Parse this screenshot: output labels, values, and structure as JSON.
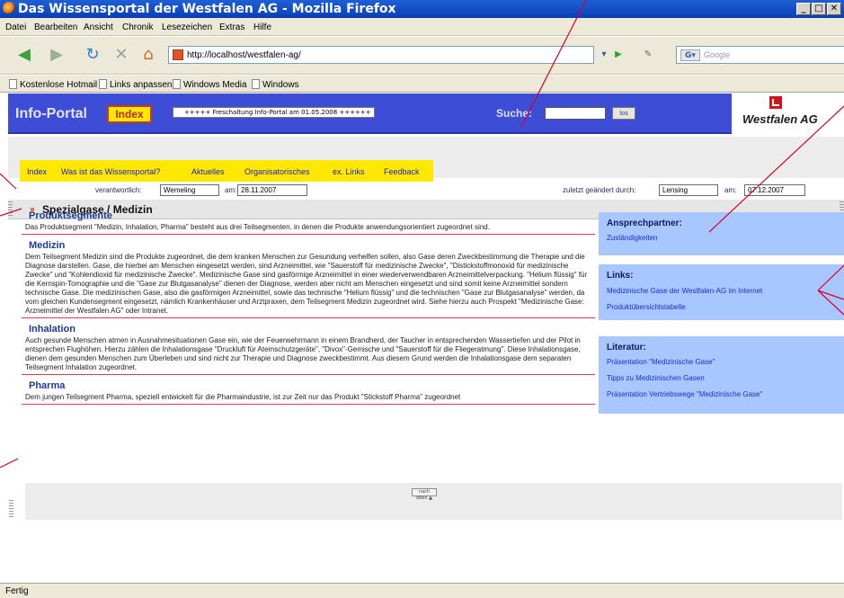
{
  "window": {
    "title": "Das Wissensportal der Westfalen AG - Mozilla Firefox",
    "controls": [
      "_",
      "□",
      "✕"
    ]
  },
  "menu": [
    "Datei",
    "Bearbeiten",
    "Ansicht",
    "Chronik",
    "Lesezeichen",
    "Extras",
    "Hilfe"
  ],
  "toolbar": {
    "url": "http://localhost/westfalen-ag/",
    "search_placeholder": "Google",
    "search_engine_label": "G"
  },
  "bookmarks": [
    "Kostenlose Hotmail",
    "Links anpassen",
    "Windows Media",
    "Windows"
  ],
  "header": {
    "brand": "Info-Portal",
    "index_button": "Index",
    "ticker": "+++++ Freschaltung Info-Portal am 01.05.2008 ++++++",
    "search_label": "Suche:",
    "search_button": "los",
    "logo_text": "Westfalen AG"
  },
  "nav": [
    "Index",
    "Was ist das Wissensportal?",
    "Aktuelles",
    "Organisatorisches",
    "ex. Links",
    "Feedback"
  ],
  "meta": {
    "responsible_label": "verantwortlich:",
    "responsible_value": "Wemeling",
    "date_label": "am:",
    "date_value": "28.11.2007",
    "changed_label": "zuletzt geändert durch:",
    "changed_value": "Lensing",
    "changed_date_label": "am:",
    "changed_date_value": "07.12.2007"
  },
  "section_title": "Spezialgase / Medizin",
  "content": [
    {
      "heading": "Produktsegmente",
      "text": "Das Produktsegment \"Medizin, Inhalation, Pharma\" besteht aus drei Teilsegmenten, in denen die Produkte anwendungsorientiert zugeordnet sind."
    },
    {
      "heading": "Medizin",
      "text": "Dem Teilsegment Medizin sind die Produkte zugeordnet, die dem kranken Menschen zur Gesundung verhelfen sollen, also Gase deren Zweckbestimmung die Therapie und die Diagnose darstellen. Gase, die hierbei am Menschen eingesetzt werden, sind Arzneimittel, wie \"Sauerstoff für medizinische Zwecke\", \"Distickstoffmonoxid für medizinische Zwecke\" und \"Kohlendioxid für medizinische Zwecke\". Medizinische Gase sind gasförmige Arzneimittel in einer wiederverwendbaren Arzneimittelverpackung. \"Helium flüssig\" für die Kernspin-Tomographie und die \"Gase zur Blutgasanalyse\" dienen der Diagnose, werden aber nicht am Menschen eingesetzt und sind somit keine Arzneimittel sondern technische Gase. Die medizinischen Gase, also die gasförmigen Arzneimittel, sowie das technische \"Helium flüssig\" und die technischen \"Gase zur Blutgasanalyse\" werden, da vom gleichen Kundensegment eingesetzt, nämlich Krankenhäuser und Arztpraxen, dem Teilsegment Medizin zugeordnet wird. Siehe hierzu auch Prospekt \"Medizinische Gase: Arzneimittel der Westfalen AG\" oder Intranet."
    },
    {
      "heading": "Inhalation",
      "text": "Auch gesunde Menschen atmen in Ausnahmesituationen Gase ein, wie der Feuerwehrmann in einem Brandherd, der Taucher in entsprechenden Wassertiefen und der Pilot in entsprechen Flughöhen. Hierzu zählen die Inhalationsgase \"Druckluft für Atemschutzgeräte\", \"Divox\"-Gemische und \"Sauerstoff für die Fliegeratmung\". Diese Inhalationsgase, dienen dem gesunden Menschen zum Überleben und sind nicht zur Therapie und Diagnose zweckbestimmt. Aus diesem Grund werden die Inhalationsgase dem separaten Teilsegment Inhalation zugeordnet."
    },
    {
      "heading": "Pharma",
      "text": "Dem jungen Teilsegment Pharma, speziell entwickelt für die Pharmaindustrie, ist zur Zeit nur das Produkt \"Stickstoff Pharma\" zugeordnet"
    }
  ],
  "back_to_top": "nach oben ▲",
  "sidebar": {
    "contacts": {
      "title": "Ansprechpartner:",
      "links": [
        "Zuständigkeiten"
      ]
    },
    "links": {
      "title": "Links:",
      "links": [
        "Medizinische Gase der Westfalen-AG im Internet",
        "Produktübersichtstabelle"
      ]
    },
    "literature": {
      "title": "Literatur:",
      "links": [
        "Präsentation \"Medizinische Gase\"",
        "Tipps zu Medizinischen Gasen",
        "Präsentation Vertriebswege \"Medizinische Gase\""
      ]
    }
  },
  "status": "Fertig",
  "colors": {
    "header_blue": "#3e4dd5",
    "nav_yellow": "#ffe800",
    "sidebar_blue": "#a8c6ff",
    "heading_blue": "#1c3a96",
    "annotation_red": "#d4002a"
  }
}
